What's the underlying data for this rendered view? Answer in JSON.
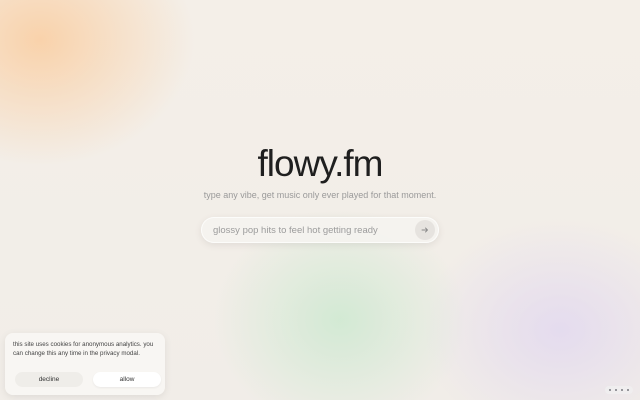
{
  "brand": {
    "logo": "flowy.fm",
    "tagline": "type any vibe, get music only ever played for that moment."
  },
  "search": {
    "placeholder": "glossy pop hits to feel hot getting ready",
    "submit_icon": "arrow-right-icon"
  },
  "cookie_banner": {
    "text": "this site uses cookies for anonymous analytics. you can change this any time in the privacy modal.",
    "decline_label": "decline",
    "allow_label": "allow"
  },
  "corner_menu": {
    "icon": "more-dots-icon"
  },
  "colors": {
    "background": "#f3efe9",
    "accent_peach": "#facda0",
    "accent_mint": "#c8e8cd",
    "accent_lavender": "#e1d7f0",
    "text_dark": "#1f1f1f"
  }
}
